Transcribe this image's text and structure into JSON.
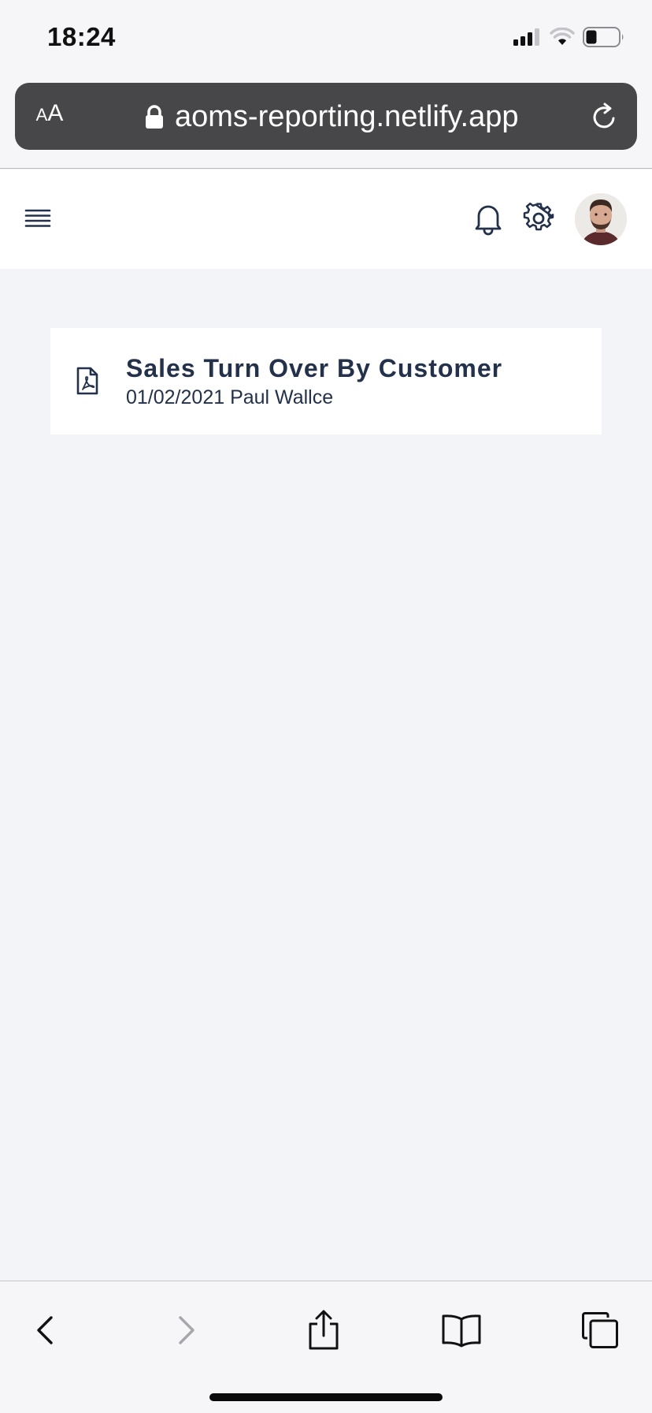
{
  "status_bar": {
    "time": "18:24",
    "icons": [
      "signal-icon",
      "wifi-icon",
      "battery-icon"
    ]
  },
  "browser": {
    "text_size_label_small": "A",
    "text_size_label_large": "A",
    "url": "aoms-reporting.netlify.app",
    "icons": [
      "lock-icon",
      "reload-icon"
    ]
  },
  "header": {
    "icons": [
      "hamburger-menu-icon",
      "bell-icon",
      "gear-icon",
      "user-avatar"
    ]
  },
  "reports": [
    {
      "title": "Sales Turn Over By Customer",
      "meta": "01/02/2021 Paul Wallce",
      "icon": "pdf-file-icon"
    }
  ],
  "toolbar": {
    "icons": [
      "back-icon",
      "forward-icon",
      "share-icon",
      "bookmarks-icon",
      "tabs-icon"
    ]
  },
  "colors": {
    "page_background": "#f3f4f8",
    "header_background": "#ffffff",
    "address_bar": "#47474a",
    "text_primary": "#23314a",
    "forward_disabled": "#a7a7ab"
  }
}
